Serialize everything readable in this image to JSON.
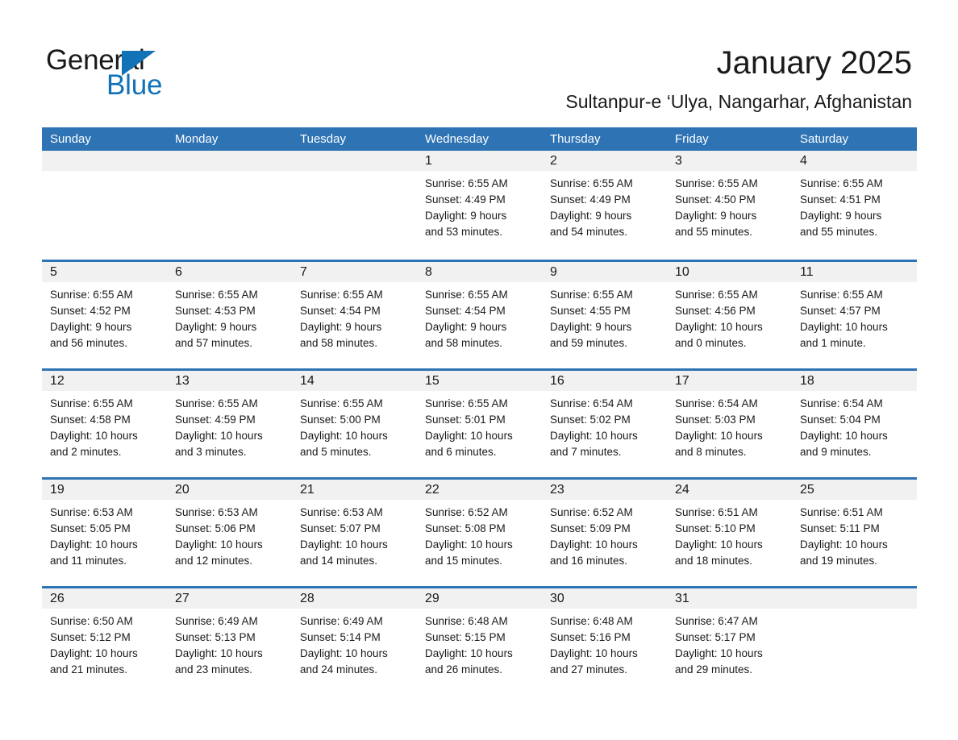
{
  "brand": {
    "name_part1": "General",
    "name_part2": "Blue",
    "accent_color": "#1272b8"
  },
  "header": {
    "title": "January 2025",
    "subtitle": "Sultanpur-e ‘Ulya, Nangarhar, Afghanistan"
  },
  "calendar": {
    "header_bg": "#2e74b5",
    "weekdays": [
      "Sunday",
      "Monday",
      "Tuesday",
      "Wednesday",
      "Thursday",
      "Friday",
      "Saturday"
    ],
    "weeks": [
      [
        {
          "day": "",
          "sunrise": "",
          "sunset": "",
          "daylight_line1": "",
          "daylight_line2": ""
        },
        {
          "day": "",
          "sunrise": "",
          "sunset": "",
          "daylight_line1": "",
          "daylight_line2": ""
        },
        {
          "day": "",
          "sunrise": "",
          "sunset": "",
          "daylight_line1": "",
          "daylight_line2": ""
        },
        {
          "day": "1",
          "sunrise": "Sunrise: 6:55 AM",
          "sunset": "Sunset: 4:49 PM",
          "daylight_line1": "Daylight: 9 hours",
          "daylight_line2": "and 53 minutes."
        },
        {
          "day": "2",
          "sunrise": "Sunrise: 6:55 AM",
          "sunset": "Sunset: 4:49 PM",
          "daylight_line1": "Daylight: 9 hours",
          "daylight_line2": "and 54 minutes."
        },
        {
          "day": "3",
          "sunrise": "Sunrise: 6:55 AM",
          "sunset": "Sunset: 4:50 PM",
          "daylight_line1": "Daylight: 9 hours",
          "daylight_line2": "and 55 minutes."
        },
        {
          "day": "4",
          "sunrise": "Sunrise: 6:55 AM",
          "sunset": "Sunset: 4:51 PM",
          "daylight_line1": "Daylight: 9 hours",
          "daylight_line2": "and 55 minutes."
        }
      ],
      [
        {
          "day": "5",
          "sunrise": "Sunrise: 6:55 AM",
          "sunset": "Sunset: 4:52 PM",
          "daylight_line1": "Daylight: 9 hours",
          "daylight_line2": "and 56 minutes."
        },
        {
          "day": "6",
          "sunrise": "Sunrise: 6:55 AM",
          "sunset": "Sunset: 4:53 PM",
          "daylight_line1": "Daylight: 9 hours",
          "daylight_line2": "and 57 minutes."
        },
        {
          "day": "7",
          "sunrise": "Sunrise: 6:55 AM",
          "sunset": "Sunset: 4:54 PM",
          "daylight_line1": "Daylight: 9 hours",
          "daylight_line2": "and 58 minutes."
        },
        {
          "day": "8",
          "sunrise": "Sunrise: 6:55 AM",
          "sunset": "Sunset: 4:54 PM",
          "daylight_line1": "Daylight: 9 hours",
          "daylight_line2": "and 58 minutes."
        },
        {
          "day": "9",
          "sunrise": "Sunrise: 6:55 AM",
          "sunset": "Sunset: 4:55 PM",
          "daylight_line1": "Daylight: 9 hours",
          "daylight_line2": "and 59 minutes."
        },
        {
          "day": "10",
          "sunrise": "Sunrise: 6:55 AM",
          "sunset": "Sunset: 4:56 PM",
          "daylight_line1": "Daylight: 10 hours",
          "daylight_line2": "and 0 minutes."
        },
        {
          "day": "11",
          "sunrise": "Sunrise: 6:55 AM",
          "sunset": "Sunset: 4:57 PM",
          "daylight_line1": "Daylight: 10 hours",
          "daylight_line2": "and 1 minute."
        }
      ],
      [
        {
          "day": "12",
          "sunrise": "Sunrise: 6:55 AM",
          "sunset": "Sunset: 4:58 PM",
          "daylight_line1": "Daylight: 10 hours",
          "daylight_line2": "and 2 minutes."
        },
        {
          "day": "13",
          "sunrise": "Sunrise: 6:55 AM",
          "sunset": "Sunset: 4:59 PM",
          "daylight_line1": "Daylight: 10 hours",
          "daylight_line2": "and 3 minutes."
        },
        {
          "day": "14",
          "sunrise": "Sunrise: 6:55 AM",
          "sunset": "Sunset: 5:00 PM",
          "daylight_line1": "Daylight: 10 hours",
          "daylight_line2": "and 5 minutes."
        },
        {
          "day": "15",
          "sunrise": "Sunrise: 6:55 AM",
          "sunset": "Sunset: 5:01 PM",
          "daylight_line1": "Daylight: 10 hours",
          "daylight_line2": "and 6 minutes."
        },
        {
          "day": "16",
          "sunrise": "Sunrise: 6:54 AM",
          "sunset": "Sunset: 5:02 PM",
          "daylight_line1": "Daylight: 10 hours",
          "daylight_line2": "and 7 minutes."
        },
        {
          "day": "17",
          "sunrise": "Sunrise: 6:54 AM",
          "sunset": "Sunset: 5:03 PM",
          "daylight_line1": "Daylight: 10 hours",
          "daylight_line2": "and 8 minutes."
        },
        {
          "day": "18",
          "sunrise": "Sunrise: 6:54 AM",
          "sunset": "Sunset: 5:04 PM",
          "daylight_line1": "Daylight: 10 hours",
          "daylight_line2": "and 9 minutes."
        }
      ],
      [
        {
          "day": "19",
          "sunrise": "Sunrise: 6:53 AM",
          "sunset": "Sunset: 5:05 PM",
          "daylight_line1": "Daylight: 10 hours",
          "daylight_line2": "and 11 minutes."
        },
        {
          "day": "20",
          "sunrise": "Sunrise: 6:53 AM",
          "sunset": "Sunset: 5:06 PM",
          "daylight_line1": "Daylight: 10 hours",
          "daylight_line2": "and 12 minutes."
        },
        {
          "day": "21",
          "sunrise": "Sunrise: 6:53 AM",
          "sunset": "Sunset: 5:07 PM",
          "daylight_line1": "Daylight: 10 hours",
          "daylight_line2": "and 14 minutes."
        },
        {
          "day": "22",
          "sunrise": "Sunrise: 6:52 AM",
          "sunset": "Sunset: 5:08 PM",
          "daylight_line1": "Daylight: 10 hours",
          "daylight_line2": "and 15 minutes."
        },
        {
          "day": "23",
          "sunrise": "Sunrise: 6:52 AM",
          "sunset": "Sunset: 5:09 PM",
          "daylight_line1": "Daylight: 10 hours",
          "daylight_line2": "and 16 minutes."
        },
        {
          "day": "24",
          "sunrise": "Sunrise: 6:51 AM",
          "sunset": "Sunset: 5:10 PM",
          "daylight_line1": "Daylight: 10 hours",
          "daylight_line2": "and 18 minutes."
        },
        {
          "day": "25",
          "sunrise": "Sunrise: 6:51 AM",
          "sunset": "Sunset: 5:11 PM",
          "daylight_line1": "Daylight: 10 hours",
          "daylight_line2": "and 19 minutes."
        }
      ],
      [
        {
          "day": "26",
          "sunrise": "Sunrise: 6:50 AM",
          "sunset": "Sunset: 5:12 PM",
          "daylight_line1": "Daylight: 10 hours",
          "daylight_line2": "and 21 minutes."
        },
        {
          "day": "27",
          "sunrise": "Sunrise: 6:49 AM",
          "sunset": "Sunset: 5:13 PM",
          "daylight_line1": "Daylight: 10 hours",
          "daylight_line2": "and 23 minutes."
        },
        {
          "day": "28",
          "sunrise": "Sunrise: 6:49 AM",
          "sunset": "Sunset: 5:14 PM",
          "daylight_line1": "Daylight: 10 hours",
          "daylight_line2": "and 24 minutes."
        },
        {
          "day": "29",
          "sunrise": "Sunrise: 6:48 AM",
          "sunset": "Sunset: 5:15 PM",
          "daylight_line1": "Daylight: 10 hours",
          "daylight_line2": "and 26 minutes."
        },
        {
          "day": "30",
          "sunrise": "Sunrise: 6:48 AM",
          "sunset": "Sunset: 5:16 PM",
          "daylight_line1": "Daylight: 10 hours",
          "daylight_line2": "and 27 minutes."
        },
        {
          "day": "31",
          "sunrise": "Sunrise: 6:47 AM",
          "sunset": "Sunset: 5:17 PM",
          "daylight_line1": "Daylight: 10 hours",
          "daylight_line2": "and 29 minutes."
        },
        {
          "day": "",
          "sunrise": "",
          "sunset": "",
          "daylight_line1": "",
          "daylight_line2": ""
        }
      ]
    ]
  }
}
